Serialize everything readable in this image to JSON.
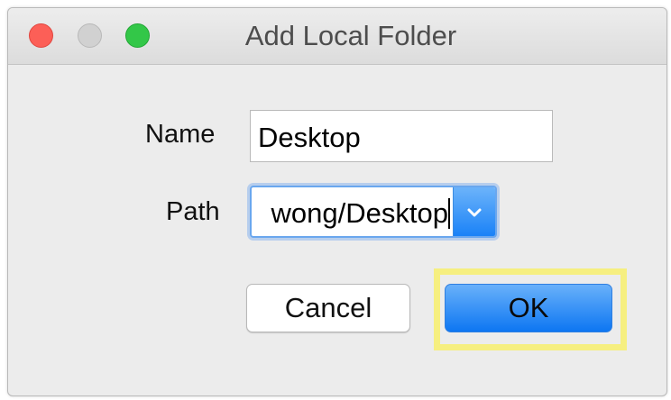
{
  "window": {
    "title": "Add Local Folder"
  },
  "form": {
    "name_label": "Name",
    "name_value": "Desktop",
    "path_label": "Path",
    "path_value": "wong/Desktop"
  },
  "buttons": {
    "cancel": "Cancel",
    "ok": "OK"
  },
  "colors": {
    "close": "#fc5f57",
    "minimize": "#d1d1d1",
    "zoom": "#33c748",
    "accent": "#1a82f7",
    "highlight": "#f6ef80"
  }
}
